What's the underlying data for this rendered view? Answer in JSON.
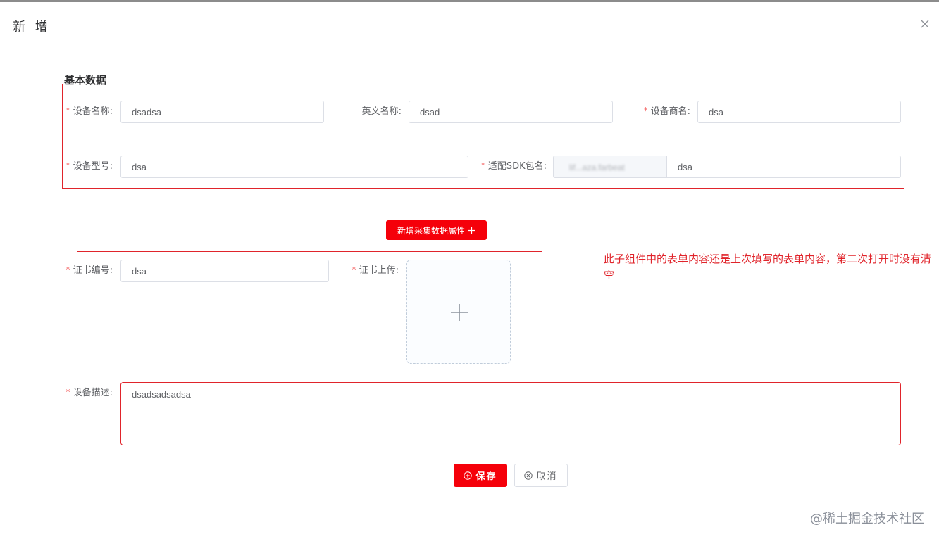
{
  "dialog": {
    "title": "新 增",
    "close_icon": "close-icon"
  },
  "basic_section": {
    "title": "基本数据",
    "fields": {
      "device_name": {
        "label": "设备名称:",
        "required": true,
        "value": "dsadsa"
      },
      "english_name": {
        "label": "英文名称:",
        "required": false,
        "value": "dsad"
      },
      "manufacturer": {
        "label": "设备商名:",
        "required": true,
        "value": "dsa"
      },
      "model": {
        "label": "设备型号:",
        "required": true,
        "value": "dsa"
      },
      "sdk_package": {
        "label": "适配SDK包名:",
        "required": true,
        "prefix": "lif...aza.farbeat",
        "value": "dsa"
      }
    }
  },
  "add_attribute_button": {
    "label": "新增采集数据属性",
    "icon": "plus-icon"
  },
  "cert_section": {
    "cert_number": {
      "label": "证书编号:",
      "required": true,
      "value": "dsa"
    },
    "cert_upload": {
      "label": "证书上传:",
      "required": true,
      "icon": "plus-icon"
    }
  },
  "description": {
    "label": "设备描述:",
    "required": true,
    "value": "dsadsadsadsa"
  },
  "annotation": {
    "note": "此子组件中的表单内容还是上次填写的表单内容，第二次打开时没有清空",
    "color": "#e0242b"
  },
  "actions": {
    "save_label": "保存",
    "save_icon": "plus-circle-icon",
    "cancel_label": "取消",
    "cancel_icon": "close-circle-icon"
  },
  "watermark": "@稀土掘金技术社区",
  "colors": {
    "primary": "#f5000a",
    "required_star": "#f56c6c",
    "annotation": "#e0242b"
  }
}
